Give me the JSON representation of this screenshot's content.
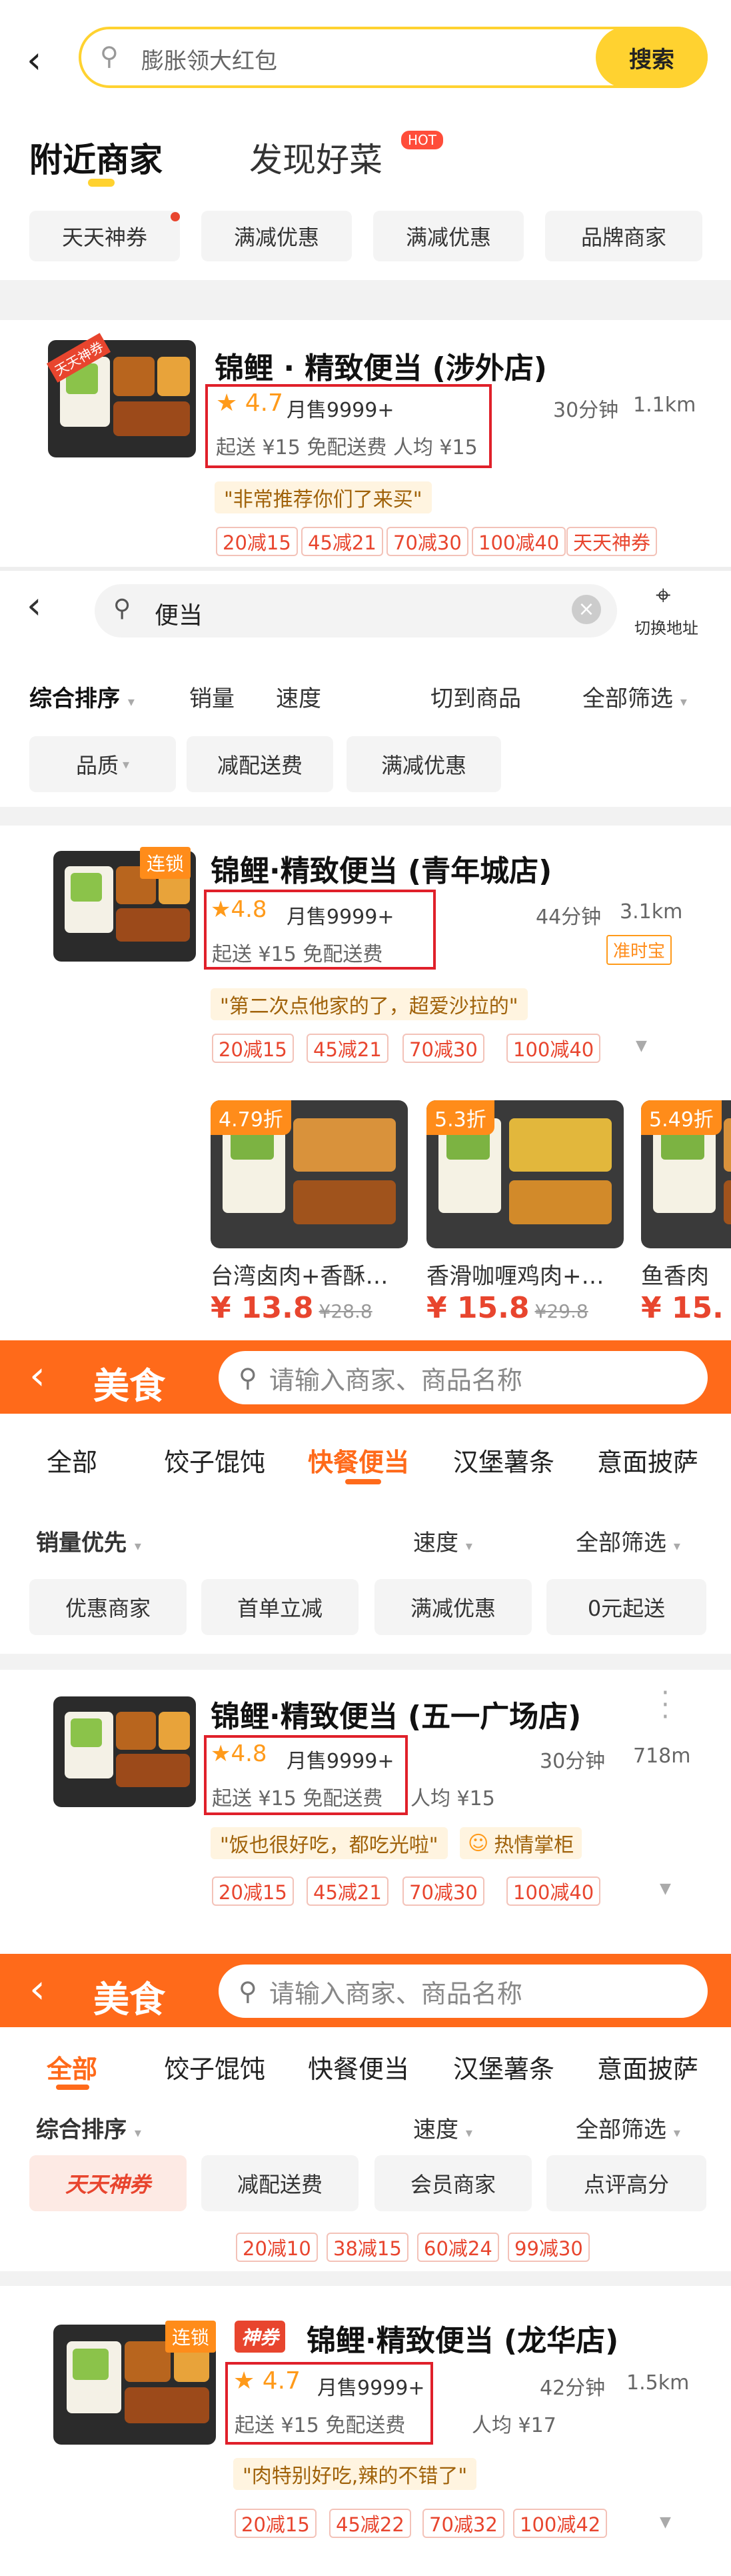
{
  "s1": {
    "search_placeholder": "膨胀领大红包",
    "search_button": "搜索",
    "tab_nearby": "附近商家",
    "tab_discover": "发现好菜",
    "hot_badge": "HOT",
    "chips": [
      "天天神券",
      "满减优惠",
      "满减优惠",
      "品牌商家"
    ],
    "shop": {
      "name": "锦鲤 · 精致便当 (涉外店)",
      "thumb_tag": "天天神券",
      "rating": "4.7",
      "monthly": "月售9999+",
      "time": "30分钟",
      "dist": "1.1km",
      "fees": "起送 ¥15  免配送费  人均 ¥15",
      "quote": "\"非常推荐你们了来买\"",
      "promos": [
        "20减15",
        "45减21",
        "70减30",
        "100减40",
        "天天神券"
      ]
    }
  },
  "s2": {
    "search_value": "便当",
    "switch_addr": "切换地址",
    "sort": "综合排序",
    "filters": [
      "销量",
      "速度",
      "切到商品",
      "全部筛选"
    ],
    "chips": [
      "品质",
      "减配送费",
      "满减优惠"
    ],
    "shop": {
      "name": "锦鲤·精致便当 (青年城店)",
      "chain": "连锁",
      "rating": "4.8",
      "monthly": "月售9999+",
      "time": "44分钟",
      "dist": "3.1km",
      "fees": "起送 ¥15  免配送费",
      "ontime": "准时宝",
      "quote": "\"第二次点他家的了，超爱沙拉的\"",
      "promos": [
        "20减15",
        "45减21",
        "70减30",
        "100减40"
      ]
    },
    "dishes": [
      {
        "discount": "4.79折",
        "name": "台湾卤肉+香酥…",
        "price": "¥ 13.8",
        "old": "¥28.8"
      },
      {
        "discount": "5.3折",
        "name": "香滑咖喱鸡肉+…",
        "price": "¥ 15.8",
        "old": "¥29.8"
      },
      {
        "discount": "5.49折",
        "name": "鱼香肉",
        "price": "¥ 15.",
        "old": ""
      }
    ]
  },
  "s3": {
    "title": "美食",
    "search_placeholder": "请输入商家、商品名称",
    "tabs": [
      "全部",
      "饺子馄饨",
      "快餐便当",
      "汉堡薯条",
      "意面披萨"
    ],
    "sort": "销量优先",
    "speed": "速度",
    "all_filter": "全部筛选",
    "chips": [
      "优惠商家",
      "首单立减",
      "满减优惠",
      "0元起送"
    ],
    "shop": {
      "name": "锦鲤·精致便当 (五一广场店)",
      "rating": "4.8",
      "monthly": "月售9999+",
      "time": "30分钟",
      "dist": "718m",
      "fees": "起送 ¥15  免配送费",
      "avg": "人均 ¥15",
      "quote": "\"饭也很好吃，都吃光啦\"",
      "hot_seller": "热情掌柜",
      "promos": [
        "20减15",
        "45减21",
        "70减30",
        "100减40"
      ]
    }
  },
  "s4": {
    "title": "美食",
    "search_placeholder": "请输入商家、商品名称",
    "tabs": [
      "全部",
      "饺子馄饨",
      "快餐便当",
      "汉堡薯条",
      "意面披萨"
    ],
    "sort": "综合排序",
    "speed": "速度",
    "all_filter": "全部筛选",
    "chips": [
      "天天神券",
      "减配送费",
      "会员商家",
      "点评高分"
    ],
    "promos_top": [
      "20减10",
      "38减15",
      "60减24",
      "99减30"
    ],
    "shop": {
      "name": "锦鲤·精致便当 (龙华店)",
      "chain": "连锁",
      "shen": "神券",
      "rating": "4.7",
      "monthly": "月售9999+",
      "time": "42分钟",
      "dist": "1.5km",
      "fees": "起送 ¥15  免配送费",
      "avg": "人均 ¥17",
      "quote": "\"肉特别好吃,辣的不错了\"",
      "promos": [
        "20减15",
        "45减22",
        "70减32",
        "100减42"
      ]
    }
  },
  "colors": {
    "accent_yellow": "#ffd230",
    "accent_orange": "#ff6a1a",
    "promo_red": "#e8452e",
    "highlight_box": "#e0202a"
  }
}
